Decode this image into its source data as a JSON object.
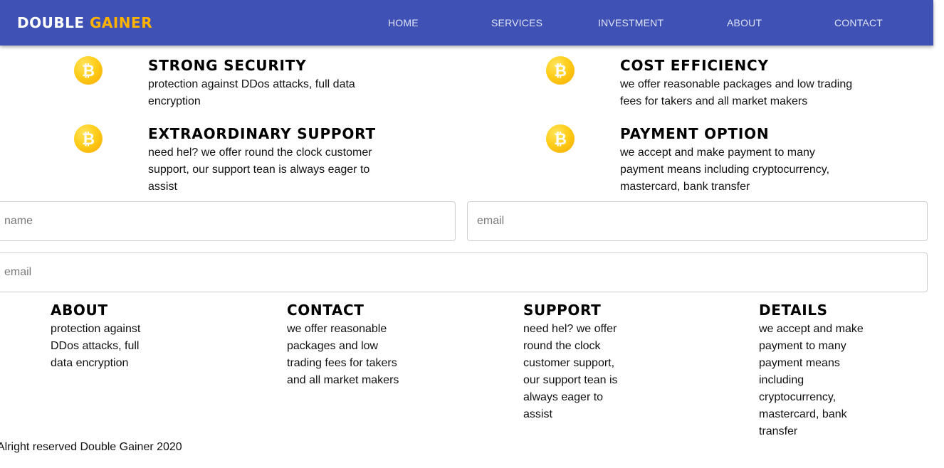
{
  "brand": {
    "first": "DOUBLE",
    "second": "GAINER"
  },
  "nav": {
    "home": "HOME",
    "services": "SERVICES",
    "investment": "INVESTMENT",
    "about": "ABOUT",
    "contact": "CONTACT"
  },
  "features": {
    "security": {
      "title": "STRONG SECURITY",
      "desc": "protection against DDos attacks, full data encryption"
    },
    "cost": {
      "title": "COST EFFICIENCY",
      "desc": "we offer reasonable packages and low trading fees for takers and all market makers"
    },
    "support": {
      "title": "EXTRAORDINARY SUPPORT",
      "desc": "need hel? we offer round the clock customer support, our support tean is always eager to assist"
    },
    "payment": {
      "title": "PAYMENT OPTION",
      "desc": "we accept and make payment to many payment means including cryptocurrency, mastercard, bank transfer"
    }
  },
  "form": {
    "name_placeholder": "name",
    "email_placeholder": "email",
    "message_placeholder": "email"
  },
  "footer": {
    "about": {
      "title": "ABOUT",
      "text": "protection against DDos attacks, full data encryption"
    },
    "contact": {
      "title": "CONTACT",
      "text": "we offer reasonable packages and low trading fees for takers and all market makers"
    },
    "support": {
      "title": "SUPPORT",
      "text": "need hel? we offer round the clock customer support, our support tean is always eager to assist"
    },
    "details": {
      "title": "DETAILS",
      "text": "we accept and make payment to many payment means including cryptocurrency, mastercard, bank transfer"
    },
    "copyright": "Alright reserved Double Gainer 2020"
  },
  "colors": {
    "navbar": "#3f51b5",
    "brand_accent": "#ffb300",
    "coin": "#ffcd1a"
  },
  "icons": {
    "feature_icon": "bitcoin-icon"
  }
}
